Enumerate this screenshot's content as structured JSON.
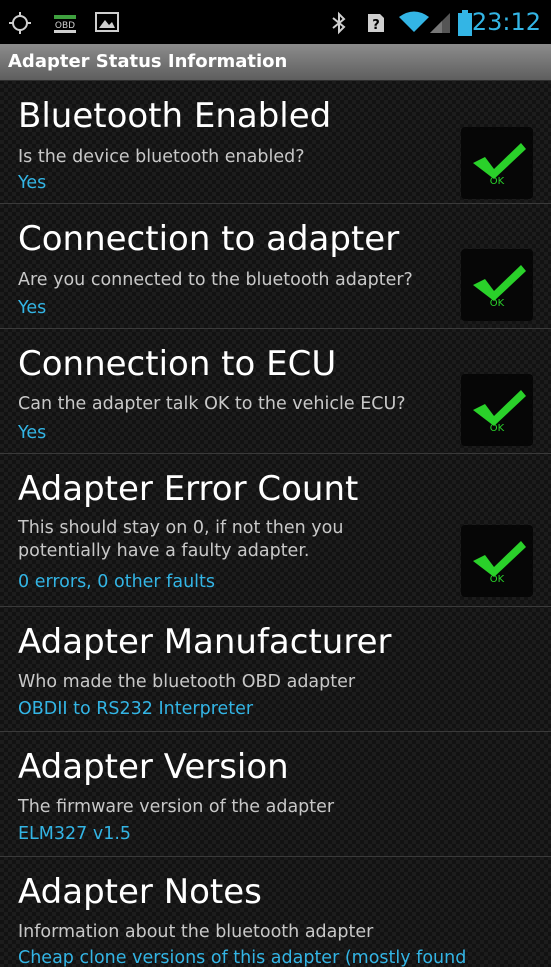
{
  "status_bar": {
    "left_icons": [
      "gps-icon",
      "obd-icon",
      "image-icon"
    ],
    "obd_label": "OBD",
    "right_icons": [
      "bluetooth-icon",
      "unknown-sim-icon",
      "wifi-icon",
      "signal-icon",
      "battery-icon"
    ],
    "sim_label": "?",
    "time": "23:12"
  },
  "title_bar": {
    "title": "Adapter Status Information"
  },
  "items": [
    {
      "title": "Bluetooth Enabled",
      "description": "Is the device bluetooth enabled?",
      "value": "Yes",
      "badge": "OK"
    },
    {
      "title": "Connection to adapter",
      "description": "Are you connected to the bluetooth adapter?",
      "value": "Yes",
      "badge": "OK"
    },
    {
      "title": "Connection to ECU",
      "description": "Can the adapter talk OK to the vehicle ECU?",
      "value": "Yes",
      "badge": "OK"
    },
    {
      "title": "Adapter Error Count",
      "description": "This should stay on 0, if not then you potentially have a faulty adapter.",
      "value": "0 errors, 0 other faults",
      "badge": "OK"
    },
    {
      "title": "Adapter Manufacturer",
      "description": "Who made the bluetooth OBD adapter",
      "value": "OBDII to RS232 Interpreter"
    },
    {
      "title": "Adapter Version",
      "description": "The firmware version of the adapter",
      "value": "ELM327 v1.5"
    },
    {
      "title": "Adapter Notes",
      "description": "Information about the bluetooth adapter",
      "value": "Cheap clone versions of this adapter (mostly found"
    }
  ],
  "colors": {
    "accent": "#33b5e5",
    "ok_green": "#2ad12a"
  }
}
